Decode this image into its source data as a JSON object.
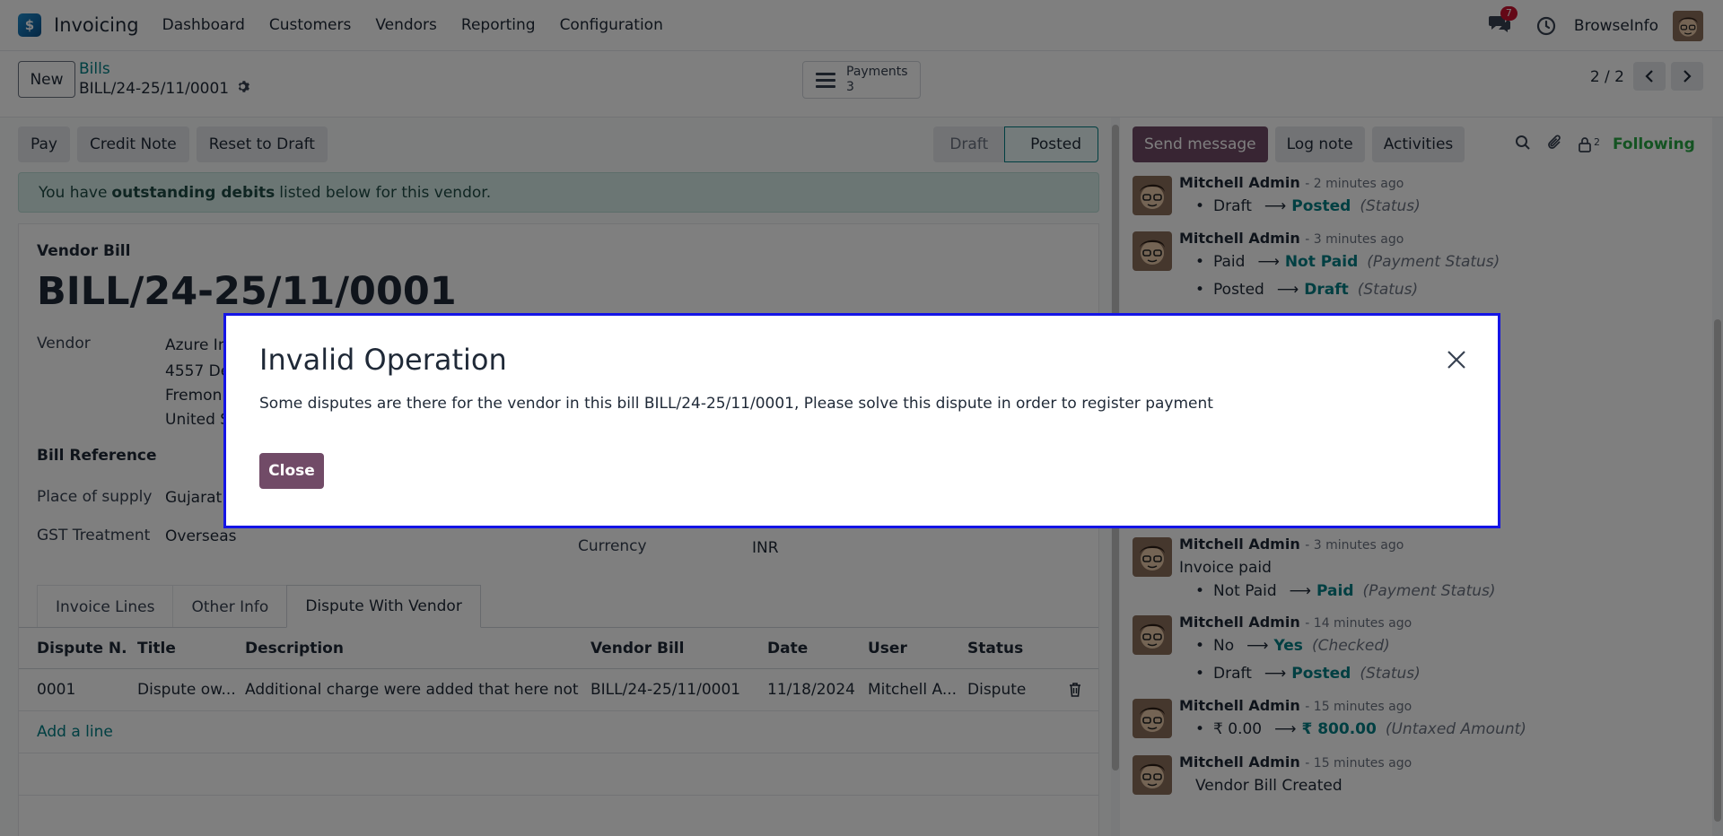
{
  "navbar": {
    "app_name": "Invoicing",
    "menu": [
      "Dashboard",
      "Customers",
      "Vendors",
      "Reporting",
      "Configuration"
    ],
    "chat_badge": "7",
    "user_name": "BrowseInfo"
  },
  "control": {
    "new_label": "New",
    "breadcrumb_parent": "Bills",
    "breadcrumb_current": "BILL/24-25/11/0001",
    "payments_label": "Payments",
    "payments_count": "3",
    "pager": "2 / 2"
  },
  "status_bar": {
    "buttons": [
      "Pay",
      "Credit Note",
      "Reset to Draft"
    ],
    "stages": [
      "Draft",
      "Posted"
    ],
    "active_stage": "Posted"
  },
  "alert": {
    "pre": "You have",
    "bold": "outstanding debits",
    "post": "listed below for this vendor."
  },
  "form": {
    "doc_type": "Vendor Bill",
    "title": "BILL/24-25/11/0001",
    "vendor_label": "Vendor",
    "vendor_name": "Azure In",
    "vendor_addr1": "4557 De",
    "vendor_addr2": "Fremon",
    "vendor_addr3": "United S",
    "bill_reference_label": "Bill Reference",
    "place_of_supply_label": "Place of supply",
    "place_of_supply_value": "Gujarat",
    "gst_treatment_label": "GST Treatment",
    "gst_treatment_value": "Overseas",
    "currency_label": "Currency",
    "currency_value": "INR"
  },
  "tabs": [
    "Invoice Lines",
    "Other Info",
    "Dispute With Vendor"
  ],
  "active_tab": "Dispute With Vendor",
  "dispute_table": {
    "headers": [
      "Dispute N...",
      "Title",
      "Description",
      "Vendor Bill",
      "Date",
      "User",
      "Status"
    ],
    "rows": [
      [
        "0001",
        "Dispute ow...",
        "Additional charge were added that here not ...",
        "BILL/24-25/11/0001",
        "11/18/2024",
        "Mitchell A...",
        "Dispute"
      ]
    ],
    "add_line": "Add a line"
  },
  "chatter": {
    "send_message": "Send message",
    "log_note": "Log note",
    "activities": "Activities",
    "followers_count": "2",
    "following": "Following",
    "messages": [
      {
        "author": "Mitchell Admin",
        "time": "- 2 minutes ago",
        "tracks": [
          [
            "Draft",
            "Posted",
            "(Status)"
          ]
        ]
      },
      {
        "author": "Mitchell Admin",
        "time": "- 3 minutes ago",
        "tracks": [
          [
            "Paid",
            "Not Paid",
            "(Payment Status)"
          ],
          [
            "Posted",
            "Draft",
            "(Status)"
          ]
        ]
      },
      {
        "author": "Mitchell Admin",
        "time": "- 3 minutes ago",
        "body": "Invoice paid",
        "tracks": [
          [
            "Not Paid",
            "Paid",
            "(Payment Status)"
          ]
        ]
      },
      {
        "author": "Mitchell Admin",
        "time": "- 14 minutes ago",
        "tracks": [
          [
            "No",
            "Yes",
            "(Checked)"
          ],
          [
            "Draft",
            "Posted",
            "(Status)"
          ]
        ]
      },
      {
        "author": "Mitchell Admin",
        "time": "- 15 minutes ago",
        "tracks": [
          [
            "₹ 0.00",
            "₹ 800.00",
            "(Untaxed Amount)"
          ]
        ]
      },
      {
        "author": "Mitchell Admin",
        "time": "- 15 minutes ago",
        "body": "Vendor Bill Created"
      }
    ]
  },
  "modal": {
    "title": "Invalid Operation",
    "body": "Some disputes are there for the vendor in this bill BILL/24-25/11/0001, Please solve this dispute in order to register payment",
    "close_label": "Close"
  },
  "colors": {
    "primary": "#714b67",
    "link": "#017e84",
    "following": "#28a745",
    "modal_border": "#1414e6"
  }
}
